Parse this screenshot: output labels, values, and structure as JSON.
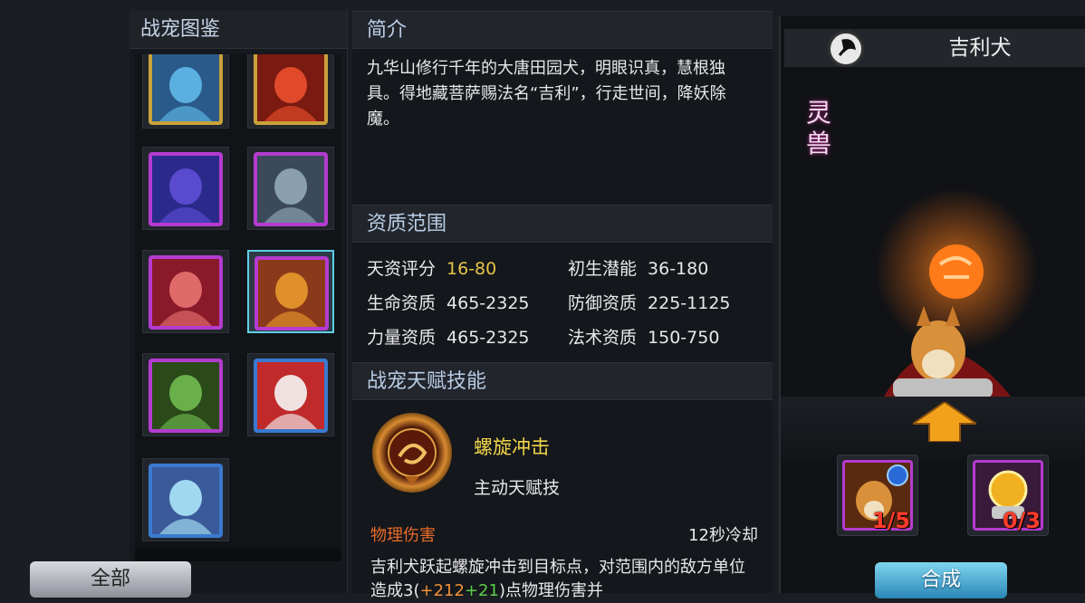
{
  "left_panel": {
    "title": "战宠图鉴",
    "all_button": "全部",
    "pets": [
      {
        "name": "pet-blue-sage",
        "border": "#c9a23a",
        "tone": [
          "#5ab0e0",
          "#2a5a8a"
        ]
      },
      {
        "name": "pet-red-warrior",
        "border": "#c9a23a",
        "tone": [
          "#e04a2a",
          "#7a1a10"
        ]
      },
      {
        "name": "pet-purple-dragon",
        "border": "#b53bd0",
        "tone": [
          "#5a4ad0",
          "#2a2a8a"
        ]
      },
      {
        "name": "pet-grey-beast",
        "border": "#b53bd0",
        "tone": [
          "#8aa0b0",
          "#3a4a5a"
        ]
      },
      {
        "name": "pet-white-hair-girl",
        "border": "#b53bd0",
        "tone": [
          "#e06a6a",
          "#8a1a2a"
        ]
      },
      {
        "name": "pet-jili-dog",
        "border": "#b53bd0",
        "tone": [
          "#e0902a",
          "#8a3a1a"
        ],
        "selected": true
      },
      {
        "name": "pet-green-monster",
        "border": "#b53bd0",
        "tone": [
          "#6ab04a",
          "#2a4a1a"
        ]
      },
      {
        "name": "pet-fox-girl",
        "border": "#3a7ad0",
        "tone": [
          "#f0e0e0",
          "#c02a2a"
        ]
      },
      {
        "name": "pet-white-deer",
        "border": "#3a7ad0",
        "tone": [
          "#a0d8f0",
          "#3a5a9a"
        ]
      }
    ]
  },
  "intro": {
    "title": "简介",
    "text": "九华山修行千年的大唐田园犬，明眼识真，慧根独具。得地藏菩萨赐法名“吉利”，行走世间，降妖除魔。"
  },
  "aptitude": {
    "title": "资质范围",
    "stats": [
      {
        "label": "天资评分",
        "value": "16-80",
        "highlight": true
      },
      {
        "label": "初生潜能",
        "value": "36-180"
      },
      {
        "label": "生命资质",
        "value": "465-2325"
      },
      {
        "label": "防御资质",
        "value": "225-1125"
      },
      {
        "label": "力量资质",
        "value": "465-2325"
      },
      {
        "label": "法术资质",
        "value": "150-750"
      }
    ]
  },
  "talent": {
    "title": "战宠天赋技能",
    "skill_name": "螺旋冲击",
    "skill_type": "主动天赋技",
    "damage_type": "物理伤害",
    "cooldown": "12秒冷却",
    "desc_part1": "吉利犬跃起螺旋冲击到目标点，对范围内的敌方单位造成3(",
    "desc_orange": "+212",
    "desc_green": "+21",
    "desc_part2": ")点物理伤害并"
  },
  "detail": {
    "type_icon": "axe-icon",
    "pet_name": "吉利犬",
    "tag": "灵兽",
    "materials": [
      {
        "name": "dog-shard",
        "count": "1/5",
        "have": 1,
        "need": 5
      },
      {
        "name": "gold-orb",
        "count": "0/3",
        "have": 0,
        "need": 3
      }
    ],
    "combine_button": "合成"
  },
  "colors": {
    "accent_gold": "#e6c34a",
    "damage_orange": "#e86a2a",
    "count_red": "#ff3c2a",
    "rare_purple": "#b53bd0"
  }
}
